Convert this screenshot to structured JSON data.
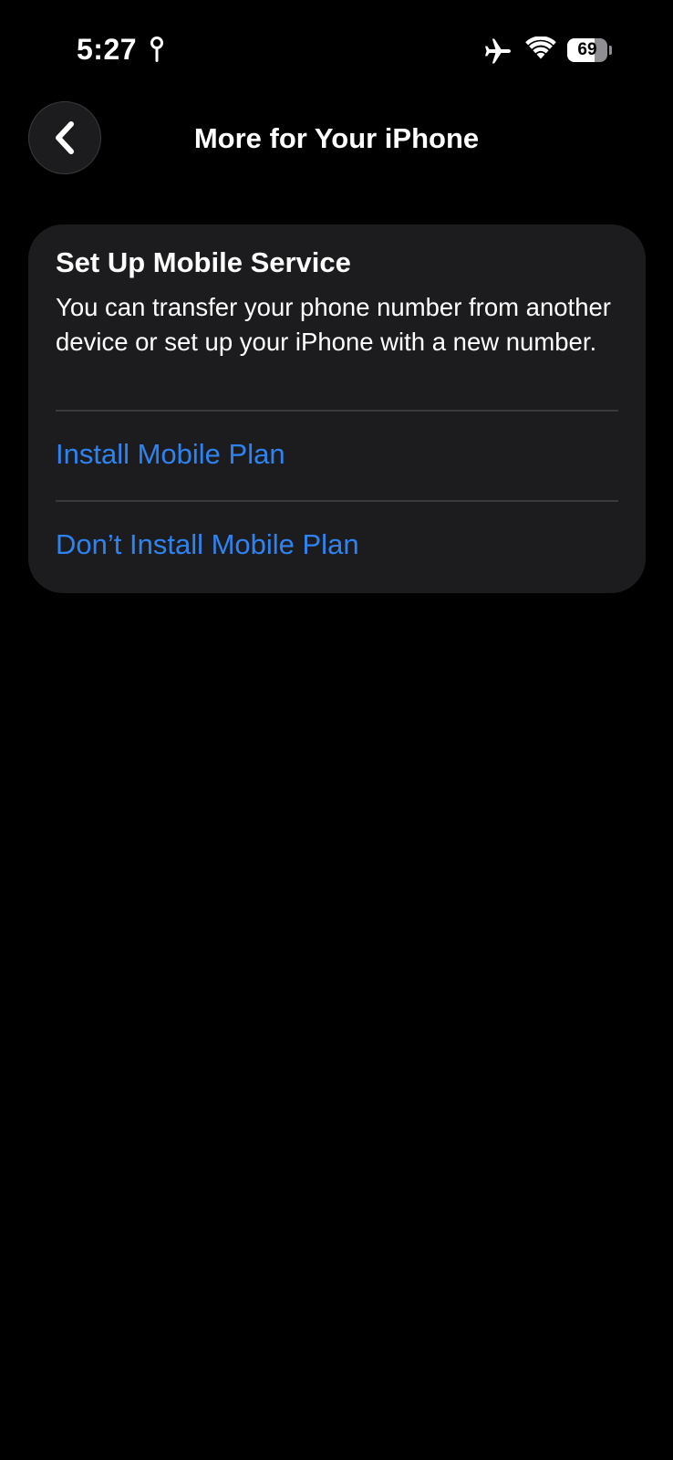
{
  "status_bar": {
    "time": "5:27",
    "battery_level": "69",
    "battery_fraction": 0.69,
    "icons": [
      "location-pin-icon",
      "airplane-icon",
      "wifi-icon",
      "battery-icon"
    ]
  },
  "nav": {
    "back_icon": "chevron-left-icon",
    "title": "More for Your iPhone"
  },
  "card": {
    "title": "Set Up Mobile Service",
    "body": "You can transfer your phone number from another device or set up your iPhone with a new number.",
    "actions": [
      {
        "label": "Install Mobile Plan"
      },
      {
        "label": "Don’t Install Mobile Plan"
      }
    ]
  },
  "colors": {
    "background": "#000000",
    "card_background": "#1c1c1e",
    "link_blue": "#2f83f0",
    "divider": "#3a3a3c",
    "text": "#ffffff"
  }
}
